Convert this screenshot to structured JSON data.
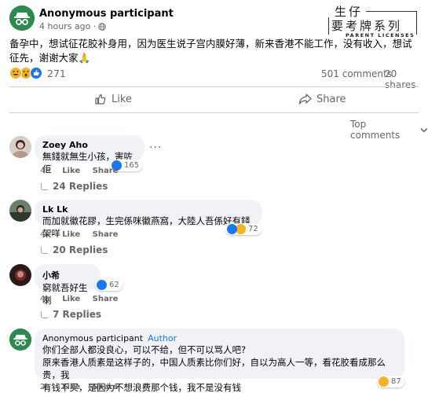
{
  "post": {
    "author": "Anonymous participant",
    "time": "4 hours ago ·",
    "text": "备孕中，想试征花胶补身用，因为医生说子宫内膜好薄，新来香港不能工作，没有收入，想试征先，谢谢大家🙏",
    "reaction_count": "271",
    "comments": "501 comments",
    "shares": "20 shares"
  },
  "logo": {
    "line1": "生仔",
    "line2": "要考牌系列",
    "line3": "PARENT LICENSES"
  },
  "actions": {
    "like": "Like",
    "share": "Share"
  },
  "top_comments": "Top comments",
  "comments": [
    {
      "name": "Zoey Aho",
      "text": "無錢就無生小孩，害咗佢",
      "time": "4h",
      "like": "Like",
      "share": "Share",
      "reactions": "165",
      "replies": "24 Replies"
    },
    {
      "name": "Lk Lk",
      "text": "而加就徽花膠，生完係咪徽燕窩，大陸人吾係好有錢架咩",
      "time": "4h",
      "like": "Like",
      "share": "Share",
      "reactions": "72",
      "replies": "20 Replies"
    },
    {
      "name": "小希",
      "text": "窮就吾好生喇",
      "time": "4h",
      "like": "Like",
      "share": "Share",
      "reactions": "62",
      "replies": "7 Replies"
    },
    {
      "name": "Anonymous participant",
      "tag": "Author",
      "text_lines": [
        "你们全部人都没良心，可以不给，但不可以骂人吧?",
        "原来香港人质素是这样子的，中国人质素比你们好，自以为高人一等，看花胶看成那么贵，我",
        "有钱不买，是因为不想浪费那个钱，我不是没有钱"
      ],
      "time": "2h",
      "like": "Like",
      "share": "Share",
      "reactions": "87"
    }
  ],
  "colors": {
    "accent": "#1877f2",
    "anon_avatar": "#2d8a4e",
    "bubble": "#f0f2f5"
  }
}
